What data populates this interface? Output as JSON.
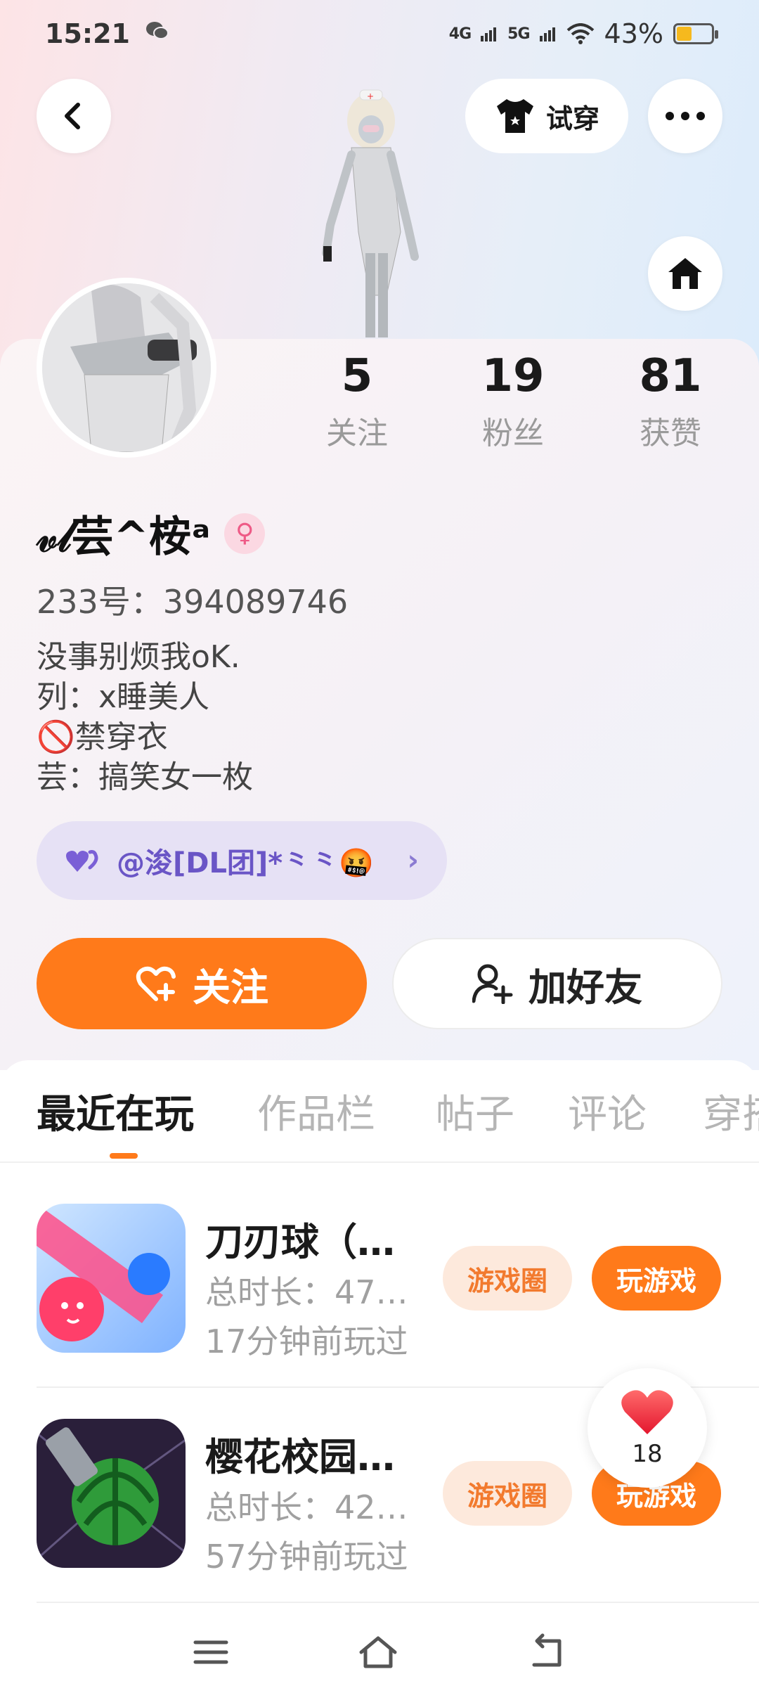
{
  "status_bar": {
    "time": "15:21",
    "wechat_icon": "wechat-icon",
    "signal_4g": "4G",
    "signal_5g": "5G",
    "battery_percent": "43%",
    "battery_level": 0.43
  },
  "header": {
    "tryon_label": "试穿"
  },
  "stats": [
    {
      "num": "5",
      "label": "关注"
    },
    {
      "num": "19",
      "label": "粉丝"
    },
    {
      "num": "81",
      "label": "获赞"
    }
  ],
  "profile": {
    "name": "𝓋𝓁芸^桉ᵃ",
    "gender_symbol": "♀",
    "uid": "233号：394089746",
    "bio": [
      "没事别烦我oK.",
      "列：x睡美人",
      "🚫禁穿衣",
      "芸：搞笑女一枚"
    ],
    "group": "@浚[DL团]*⺀⺀🤬"
  },
  "actions": {
    "follow_label": "关注",
    "addfriend_label": "加好友"
  },
  "tabs": [
    "最近在玩",
    "作品栏",
    "帖子",
    "评论",
    "穿搭"
  ],
  "games": [
    {
      "title": "刀刃球（…",
      "duration": "总时长：47…",
      "last_played": "17分钟前玩过",
      "circle_label": "游戏圈",
      "play_label": "玩游戏"
    },
    {
      "title": "樱花校园…",
      "duration": "总时长：42…",
      "last_played": "57分钟前玩过",
      "circle_label": "游戏圈",
      "play_label": "玩游戏"
    }
  ],
  "like_float": {
    "count": "18"
  },
  "colors": {
    "accent": "#ff7a1a",
    "group_text": "#6a55c6",
    "chip_bg": "#fde9dc"
  }
}
